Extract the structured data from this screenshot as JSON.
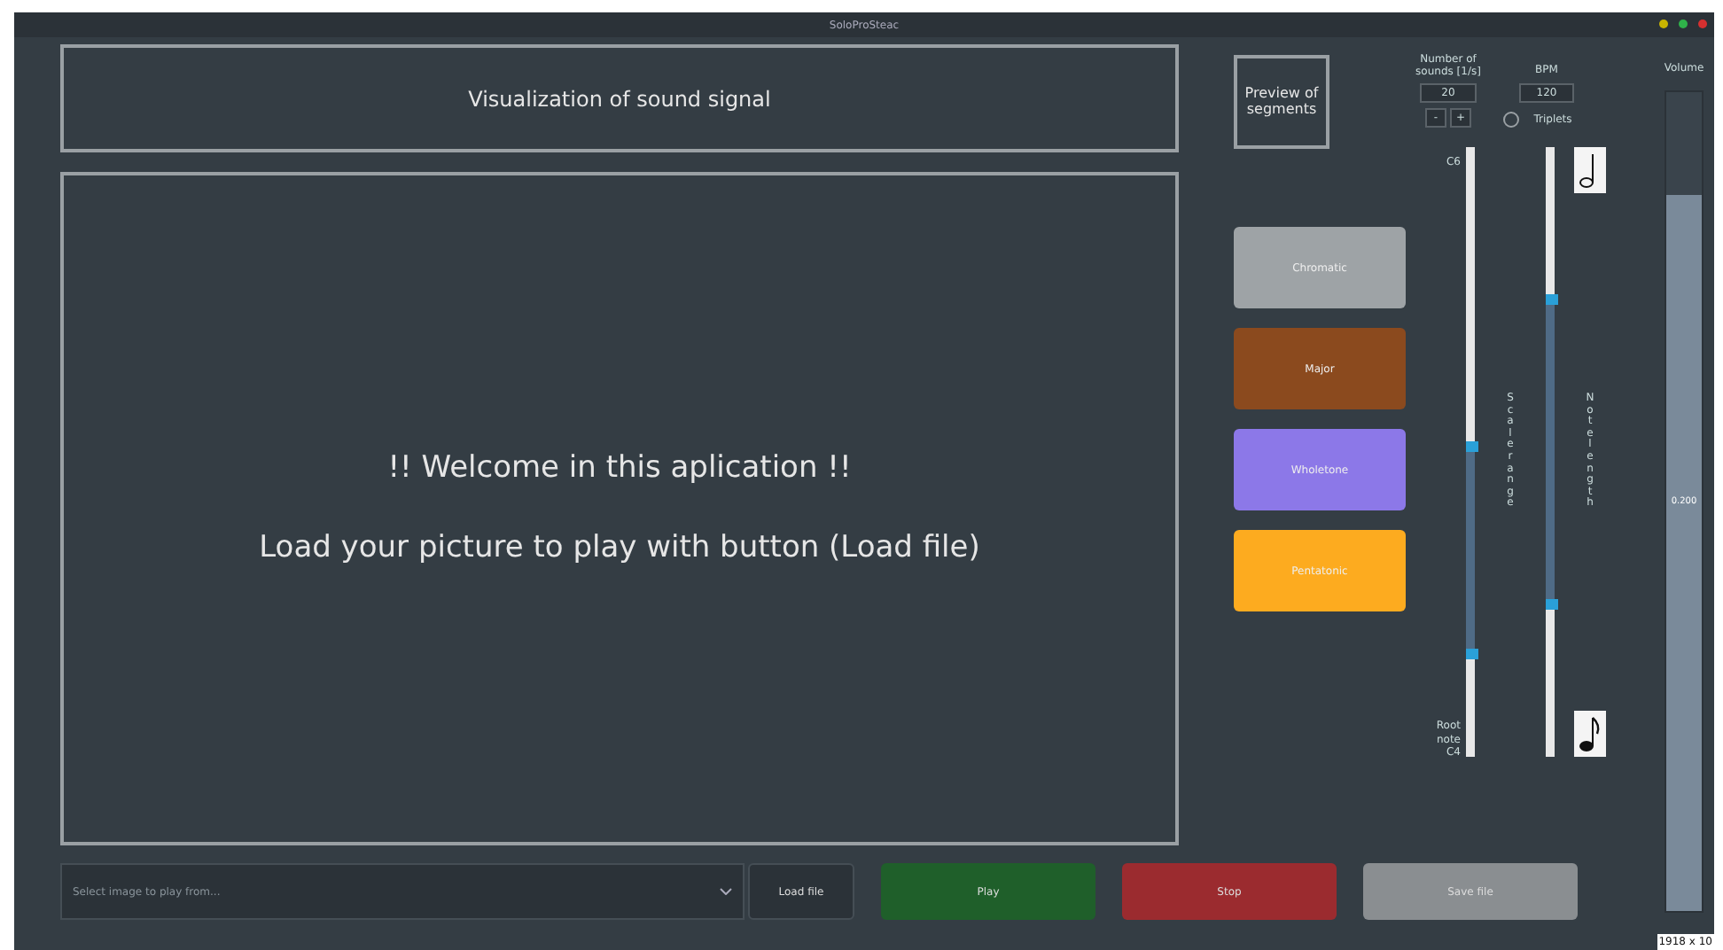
{
  "window": {
    "title": "SoloProSteac"
  },
  "visualization": {
    "title": "Visualization of sound signal"
  },
  "canvas": {
    "lines": [
      "!! Welcome in this aplication !!",
      "Load your picture to play with button (Load file)"
    ]
  },
  "preview_button": "Preview of segments",
  "scales": [
    {
      "label": "Chromatic",
      "color": "#9ea3a6"
    },
    {
      "label": "Major",
      "color": "#8b4a1e"
    },
    {
      "label": "Wholetone",
      "color": "#8c78e8"
    },
    {
      "label": "Pentatonic",
      "color": "#fdab1f"
    }
  ],
  "sounds": {
    "label": "Number of sounds [1/s]",
    "value": "20",
    "minus": "-",
    "plus": "+"
  },
  "bpm": {
    "label": "BPM",
    "value": "120"
  },
  "triplets": {
    "label": "Triplets",
    "checked": false
  },
  "range_slider": {
    "top_label": "C6",
    "bottom_label": "Root note C4",
    "caption": "Scale range",
    "handles": [
      {
        "level": 0.51
      },
      {
        "level": 0.17
      }
    ]
  },
  "length_slider": {
    "caption": "Note length",
    "handles": [
      {
        "level": 0.75
      },
      {
        "level": 0.25
      }
    ]
  },
  "volume": {
    "label": "Volume",
    "level": 0.875,
    "reading": "0.200"
  },
  "file_select": {
    "placeholder": "Select image to play from..."
  },
  "buttons": [
    {
      "label": "Load file",
      "kind": "load"
    },
    {
      "label": "Play",
      "kind": "play"
    },
    {
      "label": "Stop",
      "kind": "stop"
    },
    {
      "label": "Save file",
      "kind": "save"
    }
  ],
  "status": "1918 x 10"
}
